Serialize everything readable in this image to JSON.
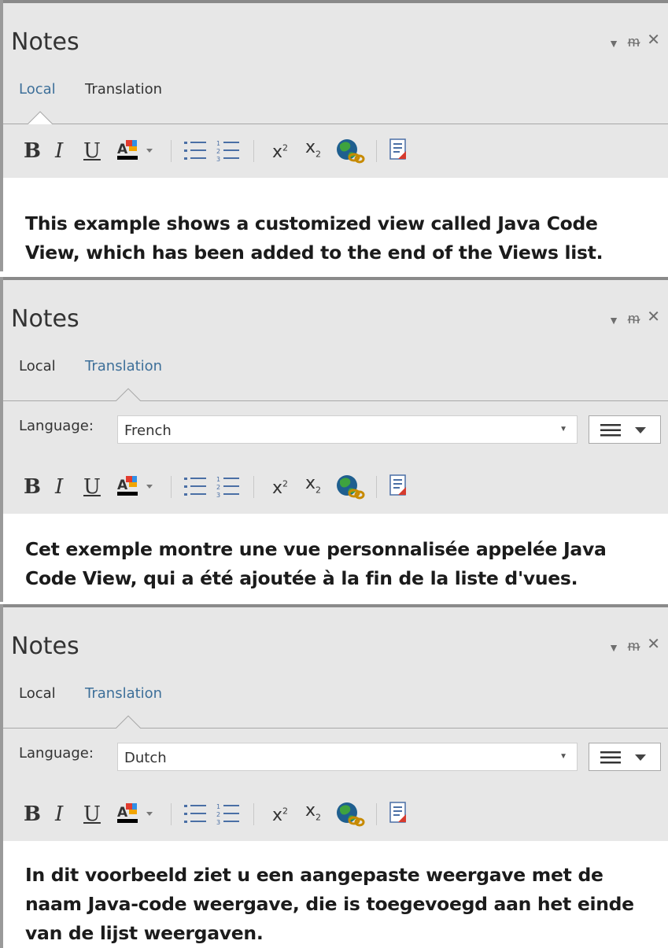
{
  "panels": [
    {
      "title": "Notes",
      "tabs": [
        "Local",
        "Translation"
      ],
      "active_tab": "Local",
      "note_text": "This example shows a customized view called Java Code View, which has been added to the end of the Views list."
    },
    {
      "title": "Notes",
      "tabs": [
        "Local",
        "Translation"
      ],
      "active_tab": "Translation",
      "language_label": "Language:",
      "language_value": "French",
      "note_text": "Cet exemple montre une vue personnalisée appelée Java Code View, qui a été ajoutée à la fin de la liste d'vues."
    },
    {
      "title": "Notes",
      "tabs": [
        "Local",
        "Translation"
      ],
      "active_tab": "Translation",
      "language_label": "Language:",
      "language_value": "Dutch",
      "note_text": "In dit voorbeeld ziet u een aangepaste weergave met de naam Java-code weergave, die is toegevoegd aan het einde van de lijst weergaven."
    }
  ],
  "toolbar": {
    "bold_glyph": "B",
    "italic_glyph": "I",
    "underline_glyph": "U",
    "color_glyph": "A",
    "superscript_glyph": "x",
    "superscript_mark": "2",
    "subscript_glyph": "x",
    "subscript_mark": "2"
  },
  "colors": {
    "header_bg": "#e7e7e7",
    "active_tab_text": "#3d6f99",
    "inactive_tab_text": "#333333"
  },
  "icons": [
    "dropdown-icon",
    "pin-icon",
    "close-icon",
    "bullet-list-icon",
    "numbered-list-icon",
    "globe-link-icon",
    "document-icon",
    "align-icon"
  ]
}
